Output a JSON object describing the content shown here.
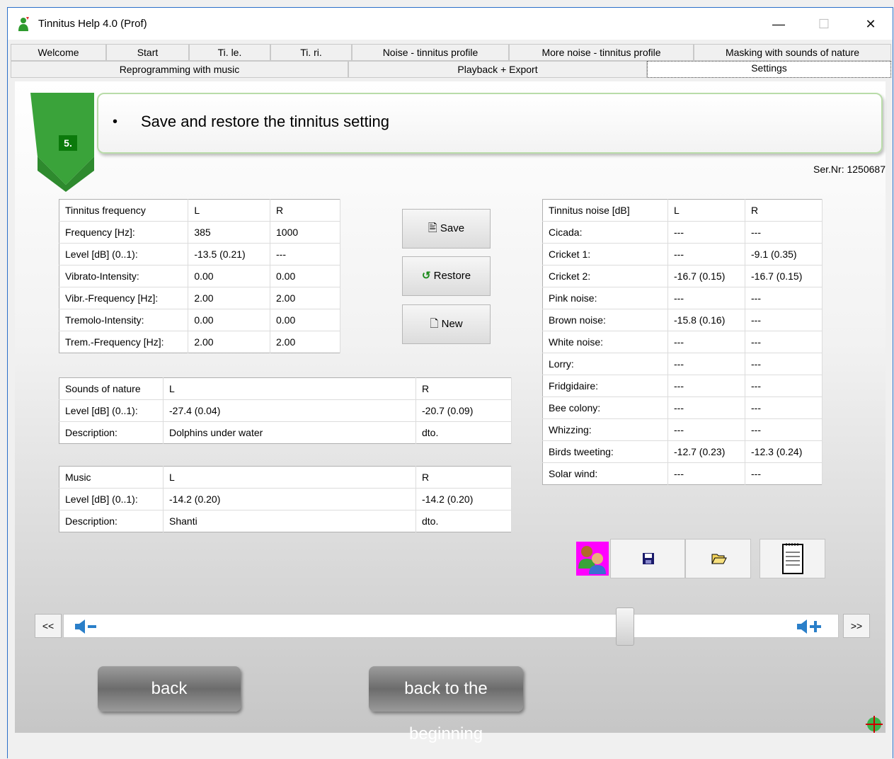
{
  "window": {
    "title": "Tinnitus Help 4.0 (Prof)"
  },
  "tabs_row1": [
    "Welcome",
    "Start",
    "Ti. le.",
    "Ti. ri.",
    "Noise - tinnitus profile",
    "More noise - tinnitus profile",
    "Masking with sounds of nature"
  ],
  "tabs_row2": [
    "Reprogramming with music",
    "Playback + Export",
    "Settings"
  ],
  "active_tab": "Settings",
  "step": {
    "number": "5.",
    "title": "Save and restore the tinnitus setting"
  },
  "serial": "Ser.Nr: 1250687",
  "tinnitus_frequency": {
    "header": [
      "Tinnitus frequency",
      "L",
      "R"
    ],
    "rows": [
      [
        "Frequency [Hz]:",
        "385",
        "1000"
      ],
      [
        "Level [dB] (0..1):",
        "-13.5 (0.21)",
        "---"
      ],
      [
        "Vibrato-Intensity:",
        "0.00",
        "0.00"
      ],
      [
        "Vibr.-Frequency [Hz]:",
        "2.00",
        "2.00"
      ],
      [
        "Tremolo-Intensity:",
        "0.00",
        "0.00"
      ],
      [
        "Trem.-Frequency [Hz]:",
        "2.00",
        "2.00"
      ]
    ]
  },
  "actions": {
    "save": "Save",
    "restore": "Restore",
    "new": "New"
  },
  "sounds_of_nature": {
    "header": [
      "Sounds of nature",
      "L",
      "R"
    ],
    "rows": [
      [
        "Level [dB] (0..1):",
        "-27.4 (0.04)",
        "-20.7 (0.09)"
      ],
      [
        "Description:",
        "Dolphins under water",
        "dto."
      ]
    ]
  },
  "music": {
    "header": [
      "Music",
      "L",
      "R"
    ],
    "rows": [
      [
        "Level [dB] (0..1):",
        "-14.2 (0.20)",
        "-14.2 (0.20)"
      ],
      [
        "Description:",
        "Shanti",
        "dto."
      ]
    ]
  },
  "tinnitus_noise": {
    "header": [
      "Tinnitus noise [dB]",
      "L",
      "R"
    ],
    "rows": [
      [
        "Cicada:",
        "---",
        "---"
      ],
      [
        "Cricket 1:",
        "---",
        "-9.1 (0.35)"
      ],
      [
        "Cricket 2:",
        "-16.7 (0.15)",
        "-16.7 (0.15)"
      ],
      [
        "Pink noise:",
        "---",
        "---"
      ],
      [
        "Brown noise:",
        "-15.8 (0.16)",
        "---"
      ],
      [
        "White noise:",
        "---",
        "---"
      ],
      [
        "Lorry:",
        "---",
        "---"
      ],
      [
        "Fridgidaire:",
        "---",
        "---"
      ],
      [
        "Bee colony:",
        "---",
        "---"
      ],
      [
        "Whizzing:",
        "---",
        "---"
      ],
      [
        "Birds tweeting:",
        "-12.7 (0.23)",
        "-12.3 (0.24)"
      ],
      [
        "Solar wind:",
        "---",
        "---"
      ]
    ]
  },
  "icons": [
    "users-icon",
    "floppy-save-icon",
    "folder-open-icon",
    "notepad-icon"
  ],
  "volume": {
    "prev": "<<",
    "next": ">>",
    "level": 0.73
  },
  "nav": {
    "back": "back",
    "beginning": "back to the beginning"
  }
}
